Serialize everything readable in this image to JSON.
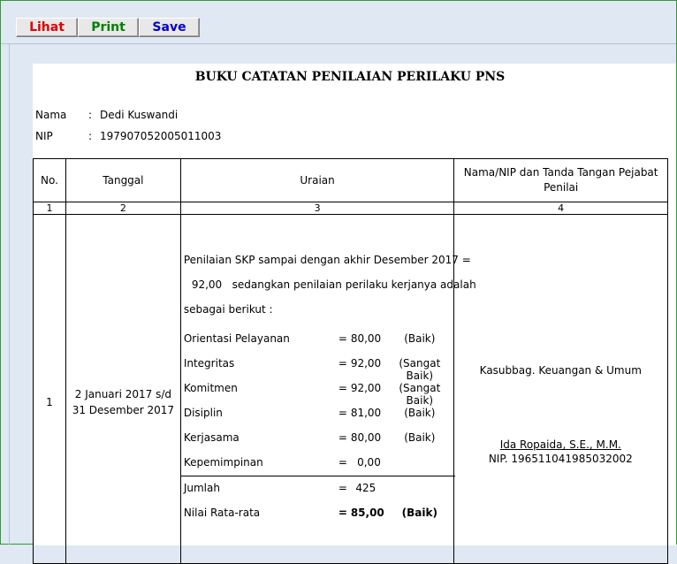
{
  "toolbar": {
    "lihat_label": "Lihat",
    "print_label": "Print",
    "save_label": "Save",
    "colors": {
      "lihat": "#e00000",
      "print": "#008000",
      "save": "#0000cc"
    }
  },
  "document": {
    "title": "BUKU CATATAN PENILAIAN PERILAKU PNS",
    "nama_label": "Nama",
    "nama_value": "Dedi Kuswandi",
    "nip_label": "NIP",
    "nip_value": "197907052005011003",
    "colon": ":"
  },
  "table": {
    "headers": [
      "No.",
      "Tanggal",
      "Uraian",
      "Nama/NIP dan Tanda Tangan Pejabat Penilai"
    ],
    "col_numbers": [
      "1",
      "2",
      "3",
      "4"
    ],
    "row": {
      "no": "1",
      "tanggal": "2 Januari 2017 s/d 31 Desember 2017",
      "uraian_intro_1": "Penilaian SKP sampai dengan akhir Desember 2017 =",
      "uraian_intro_2": "92,00   sedangkan penilaian perilaku kerjanya adalah",
      "uraian_intro_3": "sebagai berikut :",
      "scores": [
        {
          "name": "Orientasi Pelayanan",
          "eq": "=",
          "value": "80,00",
          "predicate": "(Baik)"
        },
        {
          "name": "Integritas",
          "eq": "=",
          "value": "92,00",
          "predicate": "(Sangat Baik)"
        },
        {
          "name": "Komitmen",
          "eq": "=",
          "value": "92,00",
          "predicate": "(Sangat Baik)"
        },
        {
          "name": "Disiplin",
          "eq": "=",
          "value": "81,00",
          "predicate": "(Baik)"
        },
        {
          "name": "Kerjasama",
          "eq": "=",
          "value": "80,00",
          "predicate": "(Baik)"
        },
        {
          "name": "Kepemimpinan",
          "eq": "=",
          "value": "0,00",
          "predicate": ""
        }
      ],
      "jumlah_label": "Jumlah",
      "jumlah_eq": "=",
      "jumlah_value": "425",
      "rata_label": "Nilai Rata-rata",
      "rata_eq": "=",
      "rata_value": "85,00",
      "rata_predicate": "(Baik)",
      "pejabat_jabatan": "Kasubbag. Keuangan & Umum",
      "pejabat_nama": "Ida Ropaida, S.E., M.M.",
      "pejabat_nip": "NIP. 196511041985032002"
    }
  }
}
